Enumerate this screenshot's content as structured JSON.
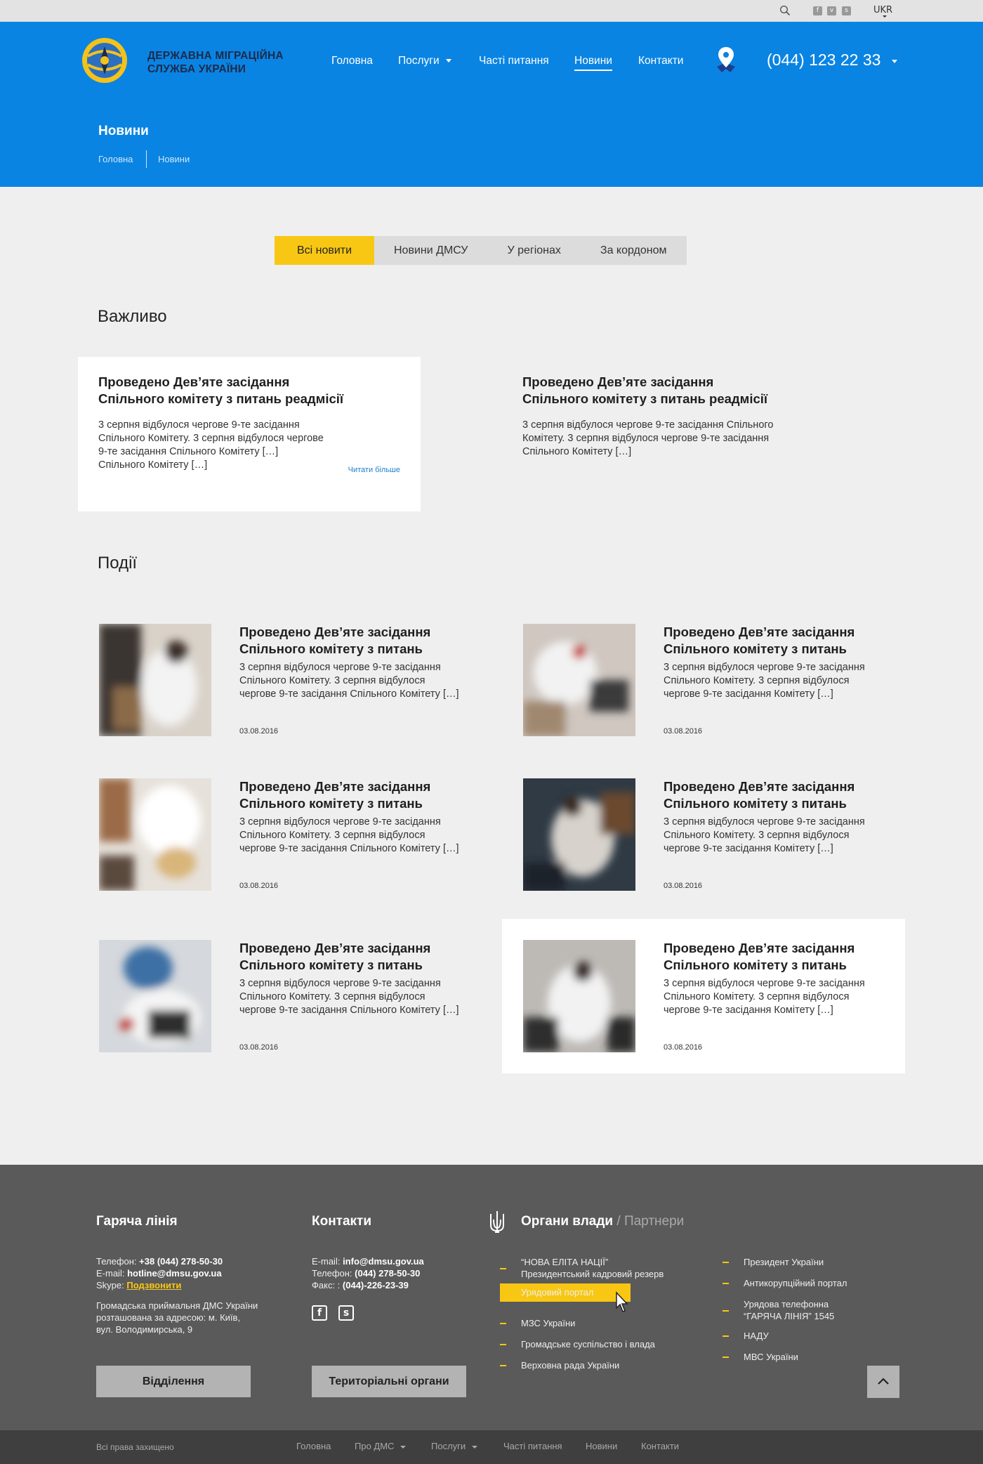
{
  "topbar": {
    "language": "UKR",
    "icons": [
      "search-icon",
      "facebook-icon",
      "vk-icon",
      "skype-icon"
    ]
  },
  "header": {
    "logo_line1": "ДЕРЖАВНА МІГРАЦІЙНА",
    "logo_line2": "СЛУЖБА УКРАЇНИ",
    "nav": [
      "Головна",
      "Послуги",
      "Часті питання",
      "Новини",
      "Контакти"
    ],
    "active_nav": "Новини",
    "phone": "(044) 123 22 33",
    "page_title": "Новини",
    "breadcrumb": [
      "Головна",
      "Новини"
    ]
  },
  "tabs": [
    "Всі новити",
    "Новини ДМСУ",
    "У регіонах",
    "За кордоном"
  ],
  "active_tab": "Всі новити",
  "important": {
    "heading": "Важливо",
    "items": [
      {
        "title_l1": "Проведено Дев’яте засідання",
        "title_l2": "Спільного комітету з питань реадмісії",
        "text": [
          "3 серпня відбулося чергове 9-те засідання",
          "Спільного Комітету. 3 серпня відбулося чергове",
          "9-те засідання Спільного Комітету […]",
          "Спільного Комітету […]"
        ],
        "more": "Читати більше"
      },
      {
        "title_l1": "Проведено Дев’яте засідання",
        "title_l2": "Спільного комітету з питань реадмісії",
        "text": [
          "3 серпня відбулося чергове 9-те засідання Спільного",
          "Комітету. 3 серпня відбулося чергове 9-те засідання",
          "Спільного Комітету […]"
        ]
      }
    ]
  },
  "events": {
    "heading": "Події",
    "items": [
      {
        "title_l1": "Проведено Дев’яте засідання",
        "title_l2": "Спільного комітету з питань",
        "text": [
          "3 серпня відбулося чергове 9-те засідання",
          "Спільного Комітету. 3 серпня відбулося",
          "чергове 9-те засідання Спільного Комітету […]"
        ],
        "date": "03.08.2016"
      },
      {
        "title_l1": "Проведено Дев’яте засідання",
        "title_l2": "Спільного комітету з питань",
        "text": [
          "3 серпня відбулося чергове 9-те засідання",
          "Спільного Комітету. 3 серпня відбулося",
          "чергове 9-те засідання  Комітету […]"
        ],
        "date": "03.08.2016"
      },
      {
        "title_l1": "Проведено Дев’яте засідання",
        "title_l2": "Спільного комітету з питань",
        "text": [
          "3 серпня відбулося чергове 9-те засідання",
          "Спільного Комітету. 3 серпня відбулося",
          "чергове 9-те засідання Спільного Комітету […]"
        ],
        "date": "03.08.2016"
      },
      {
        "title_l1": "Проведено Дев’яте засідання",
        "title_l2": "Спільного комітету з питань",
        "text": [
          "3 серпня відбулося чергове 9-те засідання",
          "Спільного Комітету. 3 серпня відбулося",
          "чергове 9-те засідання  Комітету […]"
        ],
        "date": "03.08.2016"
      },
      {
        "title_l1": "Проведено Дев’яте засідання",
        "title_l2": "Спільного комітету з питань",
        "text": [
          "3 серпня відбулося чергове 9-те засідання",
          "Спільного Комітету. 3 серпня відбулося",
          "чергове 9-те засідання Спільного Комітету […]"
        ],
        "date": "03.08.2016"
      },
      {
        "title_l1": "Проведено Дев’яте засідання",
        "title_l2": "Спільного комітету з питань",
        "text": [
          "3 серпня відбулося чергове 9-те засідання",
          "Спільного Комітету. 3 серпня відбулося",
          "чергове 9-те засідання  Комітету […]"
        ],
        "date": "03.08.2016"
      }
    ]
  },
  "footer": {
    "hotline": {
      "heading": "Гаряча лінія",
      "phone_label": "Телефон: ",
      "phone": "+38 (044) 278-50-30",
      "email_label": "E-mail: ",
      "email": "hotline@dmsu.gov.ua",
      "skype_label": "Skype: ",
      "skype_link": "Подзвонити",
      "address": [
        "Громадська приймальня ДМС України",
        "розташована за адресою: м. Київ,",
        "вул. Володимирська, 9"
      ],
      "button": "Відділення"
    },
    "contacts": {
      "heading": "Контакти",
      "email_label": "E-mail: ",
      "email": "info@dmsu.gov.ua",
      "phone_label": "Телефон: ",
      "phone": "(044) 278-50-30",
      "fax_label": "Факс: : ",
      "fax": "(044)-226-23-39",
      "button": "Територіальні органи"
    },
    "partners": {
      "heading": "Органи влади",
      "heading_dim": " / Партнери",
      "left": [
        "“НОВА ЕЛІТА НАЦІЇ”",
        "Президентський кадровий резерв",
        "Урядовий портал",
        "МЗС України",
        "Громадське суспільство і влада",
        "Верховна рада України"
      ],
      "right": [
        "Президент України",
        "Антикорупційний портал",
        "Урядова телефонна",
        "“ГАРЯЧА ЛІНІЯ” 1545",
        "НАДУ",
        "МВС України"
      ]
    }
  },
  "bottombar": {
    "copyright": "Всі права захищено",
    "nav": [
      "Головна",
      "Про ДМС",
      "Послуги",
      "Часті питання",
      "Новини",
      "Контакти"
    ]
  },
  "colors": {
    "brand_blue": "#0a84e3",
    "accent_yellow": "#f8c713",
    "footer_bg": "#5a5a5a"
  }
}
